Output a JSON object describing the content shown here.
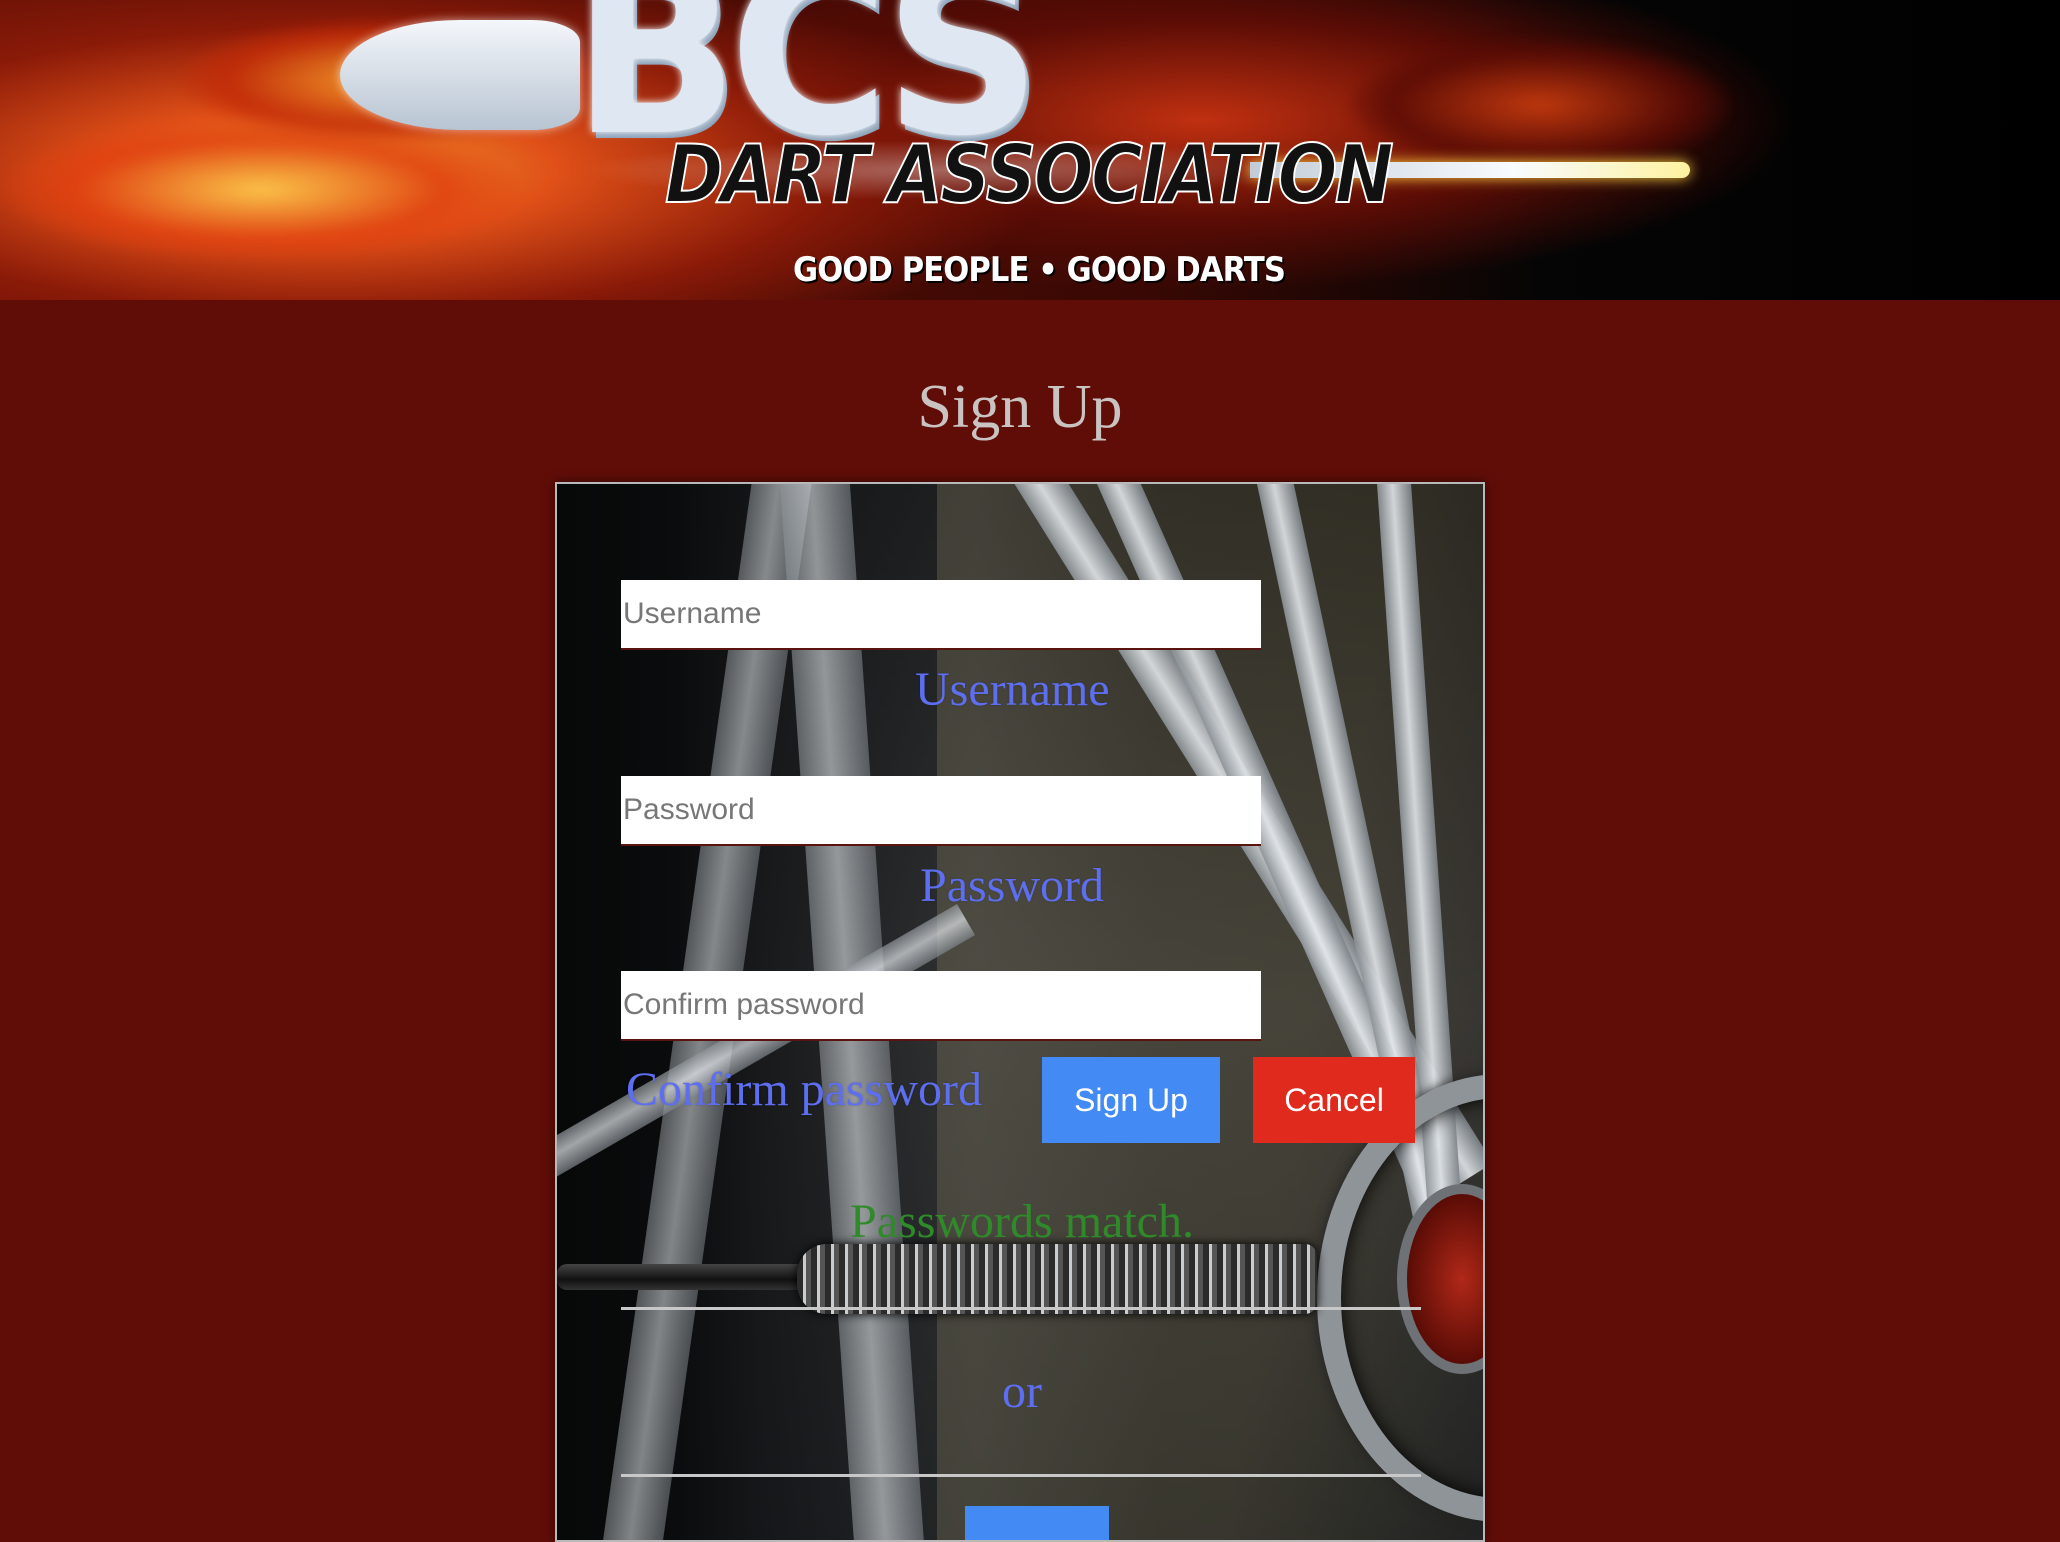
{
  "banner": {
    "logo_letters": "BCS",
    "title": "DART ASSOCIATION",
    "tagline": "GOOD PEOPLE • GOOD DARTS"
  },
  "page": {
    "title": "Sign Up"
  },
  "form": {
    "username": {
      "placeholder": "Username",
      "value": "",
      "label": "Username"
    },
    "password": {
      "placeholder": "Password",
      "value": "",
      "label": "Password"
    },
    "confirm_password": {
      "placeholder": "Confirm password",
      "value": "",
      "label": "Confirm password"
    },
    "signup_button": "Sign Up",
    "cancel_button": "Cancel",
    "status_message": "Passwords match.",
    "divider_text": "or"
  },
  "colors": {
    "page_background": "#600d08",
    "label": "#5e6ef0",
    "primary_button": "#448af4",
    "cancel_button": "#e02a1e",
    "success_text": "#2f8a2a"
  }
}
